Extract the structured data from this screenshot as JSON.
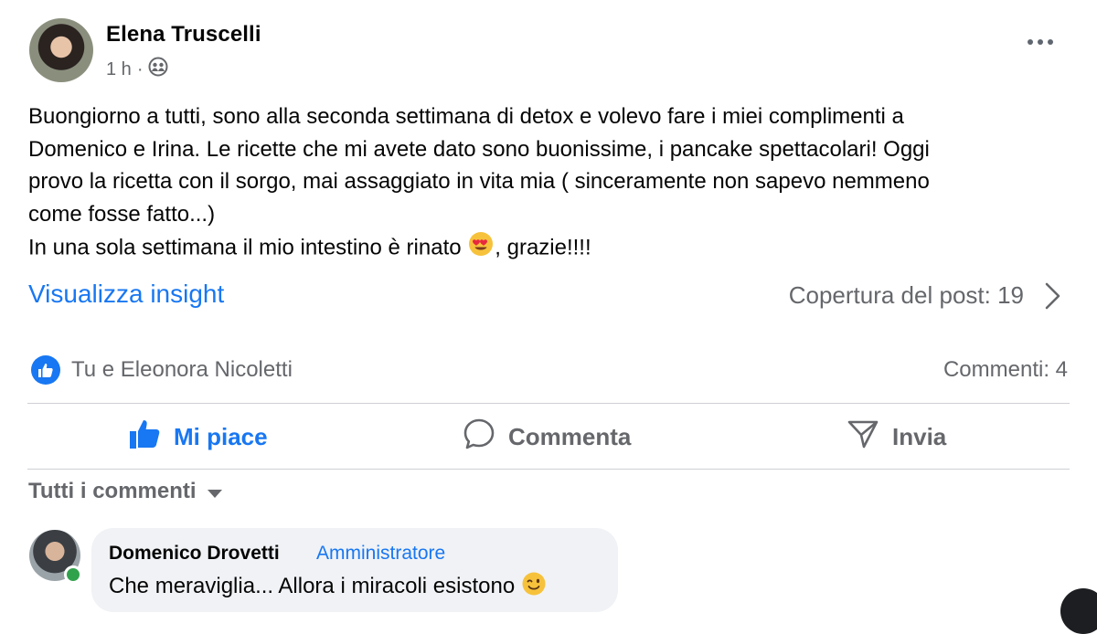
{
  "post": {
    "author": "Elena Truscelli",
    "time": "1 h",
    "separator": "·",
    "privacy_icon": "friends-icon",
    "more_icon": "more-options-icon",
    "text_lines": [
      "Buongiorno a tutti, sono alla seconda settimana di detox e volevo fare i miei complimenti a",
      "Domenico e Irina.  Le ricette che mi avete dato sono buonissime, i pancake spettacolari! Oggi",
      "provo la ricetta con il sorgo, mai assaggiato in vita mia ( sinceramente non sapevo nemmeno",
      "come fosse fatto...)"
    ],
    "last_line_before": "In una sola settimana il mio intestino è rinato ",
    "last_line_emoji": "heart-eyes-emoji",
    "last_line_after": ", grazie!!!!"
  },
  "insights": {
    "link_label": "Visualizza insight",
    "coverage_label": "Copertura del post: 19"
  },
  "reactions": {
    "names": "Tu e Eleonora Nicoletti",
    "comments_count": "Commenti: 4"
  },
  "actions": {
    "like": "Mi piace",
    "comment": "Commenta",
    "send": "Invia"
  },
  "comments_filter": "Tutti i commenti",
  "comment": {
    "author": "Domenico Drovetti",
    "role": "Amministratore",
    "text": "Che meraviglia... Allora i miracoli esistono ",
    "emoji": "wink-emoji"
  },
  "colors": {
    "accent": "#1877f2",
    "secondary_text": "#65676b",
    "bubble": "#f0f2f5",
    "online": "#31a24c"
  }
}
